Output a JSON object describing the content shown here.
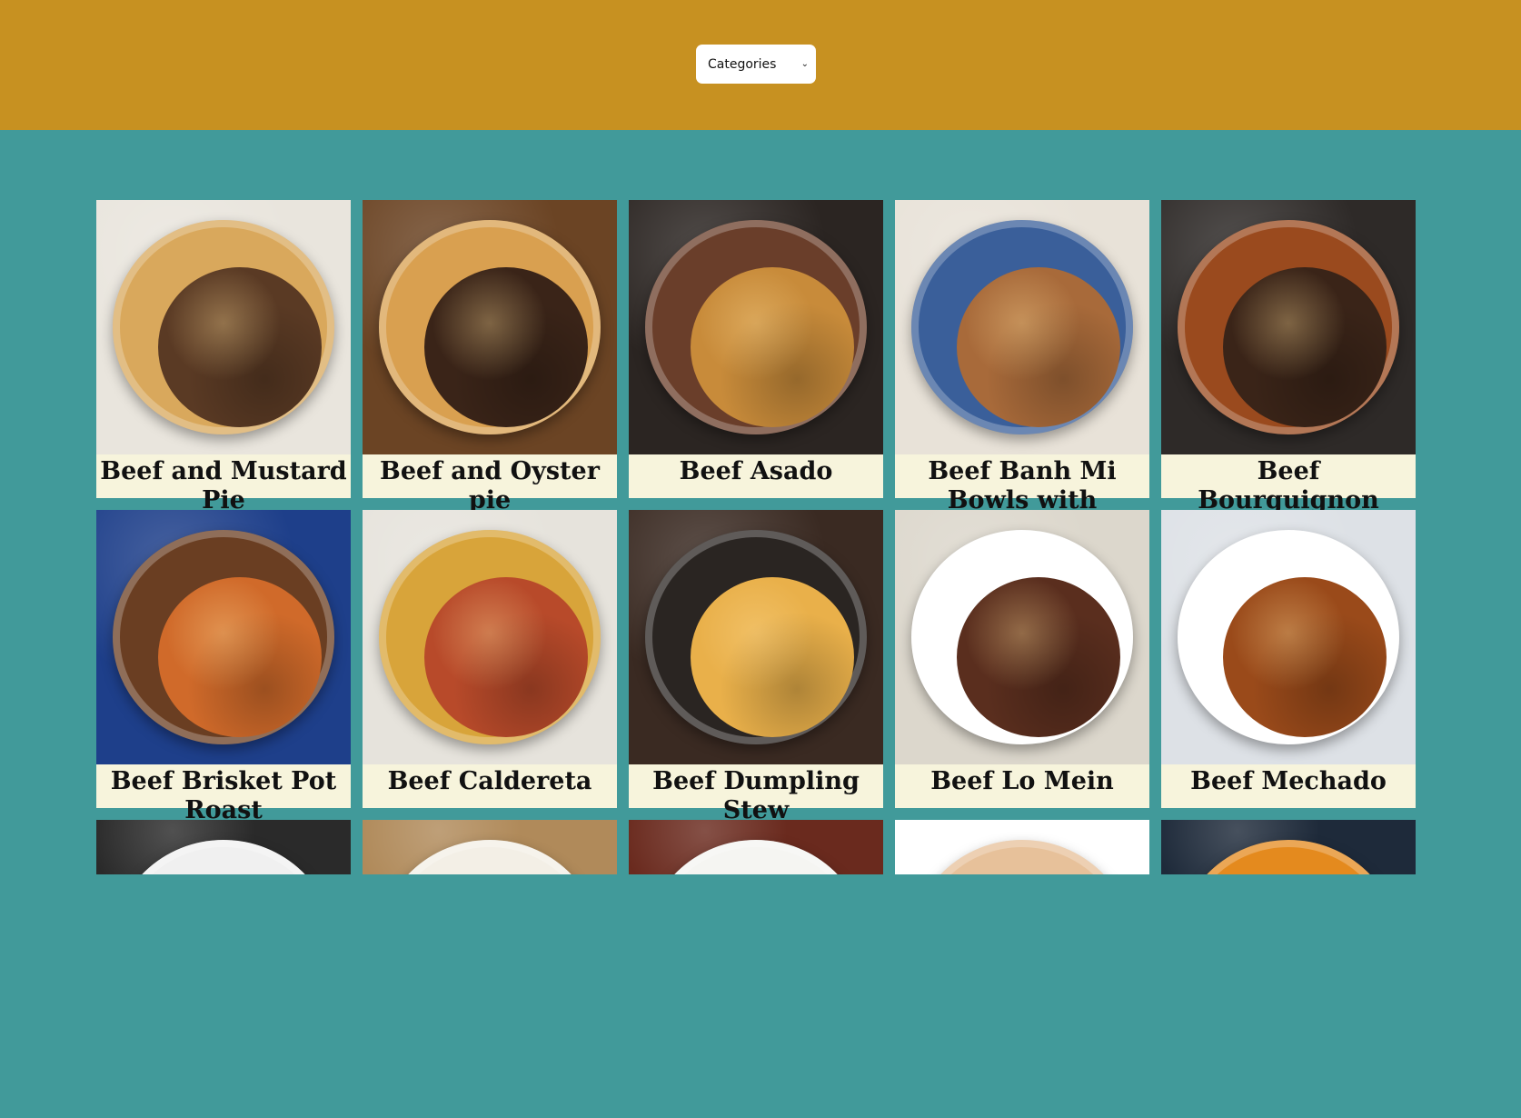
{
  "header": {
    "select_label": "Categories"
  },
  "meals": [
    {
      "name": "Beef and Mustard Pie",
      "colors": [
        "#e9e5dd",
        "#d9a85c",
        "#5a3a24"
      ]
    },
    {
      "name": "Beef and Oyster pie",
      "colors": [
        "#6b4424",
        "#d9a050",
        "#3a2418"
      ]
    },
    {
      "name": "Beef Asado",
      "colors": [
        "#2b2522",
        "#6a3e2a",
        "#c88b3a"
      ]
    },
    {
      "name": "Beef Banh Mi Bowls with Sriracha Mayo, Carrot & Pickled Cucumber",
      "colors": [
        "#e8e2d8",
        "#3a5f9a",
        "#a86a3a"
      ]
    },
    {
      "name": "Beef Bourguignon",
      "colors": [
        "#2e2a28",
        "#9a4a1e",
        "#3a2418"
      ]
    },
    {
      "name": "Beef Brisket Pot Roast",
      "colors": [
        "#1e3f8a",
        "#6a3e22",
        "#d06a2a"
      ]
    },
    {
      "name": "Beef Caldereta",
      "colors": [
        "#e6e3dc",
        "#d8a43a",
        "#b84a2a"
      ]
    },
    {
      "name": "Beef Dumpling Stew",
      "colors": [
        "#3a2a22",
        "#2a2522",
        "#e9b04a"
      ]
    },
    {
      "name": "Beef Lo Mein",
      "colors": [
        "#dcd7cc",
        "#ffffff",
        "#5a2e1e"
      ]
    },
    {
      "name": "Beef Mechado",
      "colors": [
        "#dde1e6",
        "#ffffff",
        "#9a4a1a"
      ]
    },
    {
      "name": "",
      "colors": [
        "#2a2a2a",
        "#f0f0f0",
        "#8a6a4a"
      ]
    },
    {
      "name": "",
      "colors": [
        "#b08a5a",
        "#f3efe6",
        "#7a5a3a"
      ]
    },
    {
      "name": "",
      "colors": [
        "#6a2a1e",
        "#f5f5f2",
        "#3a1a10"
      ]
    },
    {
      "name": "",
      "colors": [
        "#ffffff",
        "#e7c19a",
        "#b06a3a"
      ]
    },
    {
      "name": "",
      "colors": [
        "#1e2a3a",
        "#e48a1e",
        "#c86a1a"
      ]
    }
  ]
}
